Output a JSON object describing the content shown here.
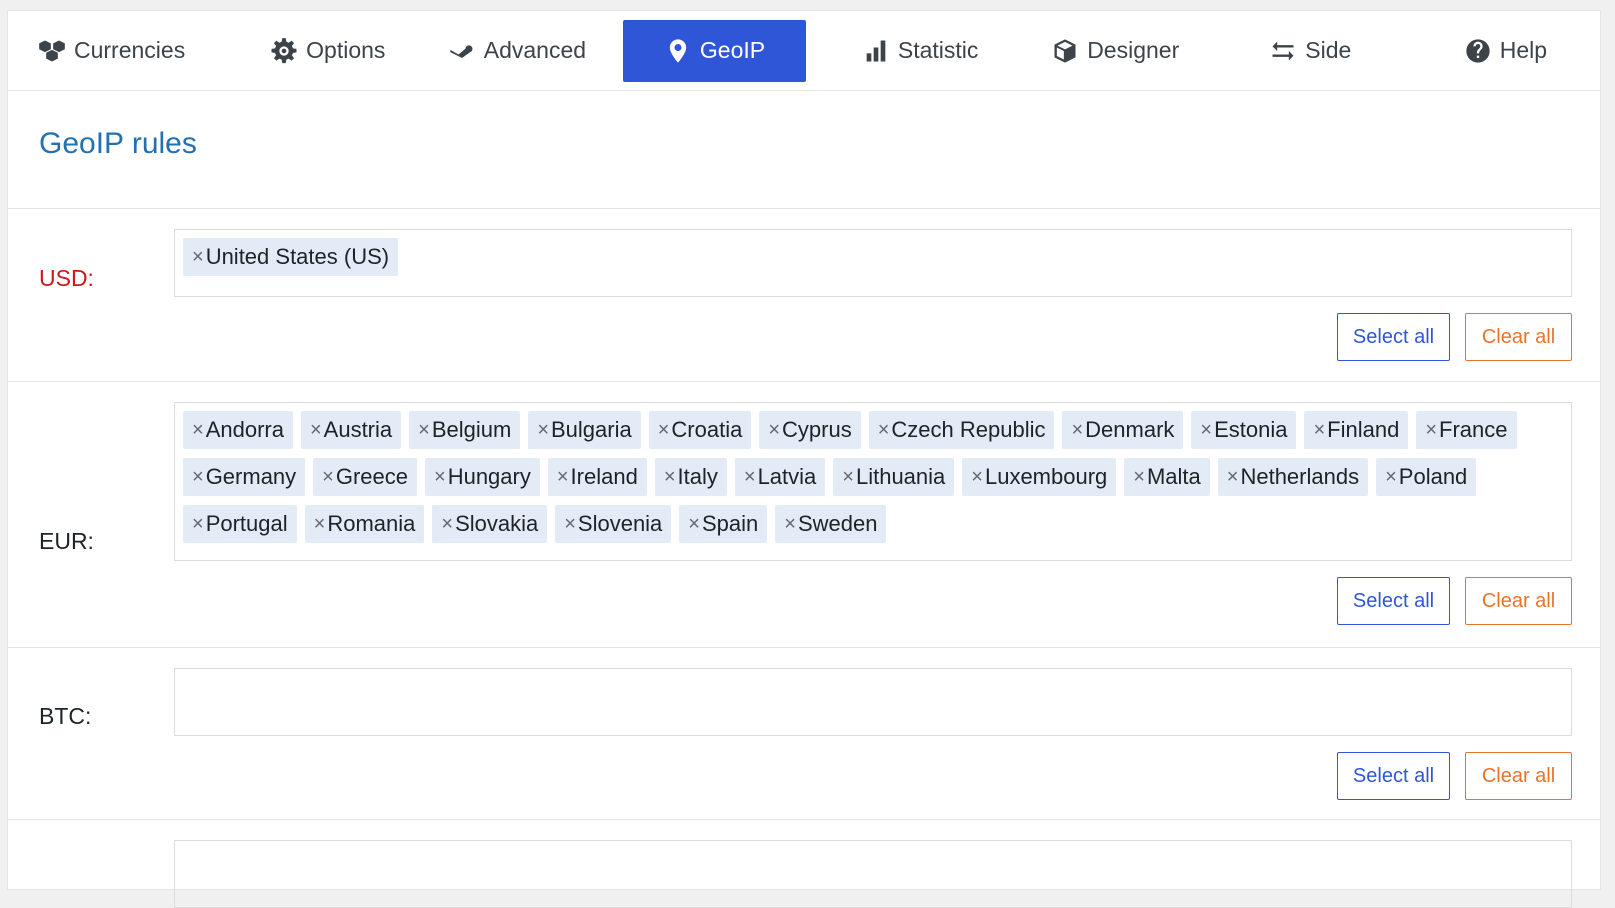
{
  "tabs": [
    {
      "label": "Currencies",
      "icon": "cubes-icon"
    },
    {
      "label": "Options",
      "icon": "gear-icon"
    },
    {
      "label": "Advanced",
      "icon": "steam-icon"
    },
    {
      "label": "GeoIP",
      "icon": "map-pin-icon",
      "active": true
    },
    {
      "label": "Statistic",
      "icon": "bar-chart-icon"
    },
    {
      "label": "Designer",
      "icon": "cube-icon"
    },
    {
      "label": "Side",
      "icon": "arrows-exchange-icon"
    },
    {
      "label": "Help",
      "icon": "question-circle-icon"
    }
  ],
  "page": {
    "title": "GeoIP rules"
  },
  "buttons": {
    "select_all": "Select all",
    "clear_all": "Clear all"
  },
  "rules": [
    {
      "currency": "USD:",
      "countries": [
        "United States (US)"
      ]
    },
    {
      "currency": "EUR:",
      "countries": [
        "Andorra",
        "Austria",
        "Belgium",
        "Bulgaria",
        "Croatia",
        "Cyprus",
        "Czech Republic",
        "Denmark",
        "Estonia",
        "Finland",
        "France",
        "Germany",
        "Greece",
        "Hungary",
        "Ireland",
        "Italy",
        "Latvia",
        "Lithuania",
        "Luxembourg",
        "Malta",
        "Netherlands",
        "Poland",
        "Portugal",
        "Romania",
        "Slovakia",
        "Slovenia",
        "Spain",
        "Sweden"
      ]
    },
    {
      "currency": "BTC:",
      "countries": []
    }
  ],
  "colors": {
    "accent": "#2f56d6",
    "clear": "#e8742c",
    "usd_label": "#cc1818",
    "heading": "#2271b1",
    "tag_bg": "#e3ebf6"
  }
}
